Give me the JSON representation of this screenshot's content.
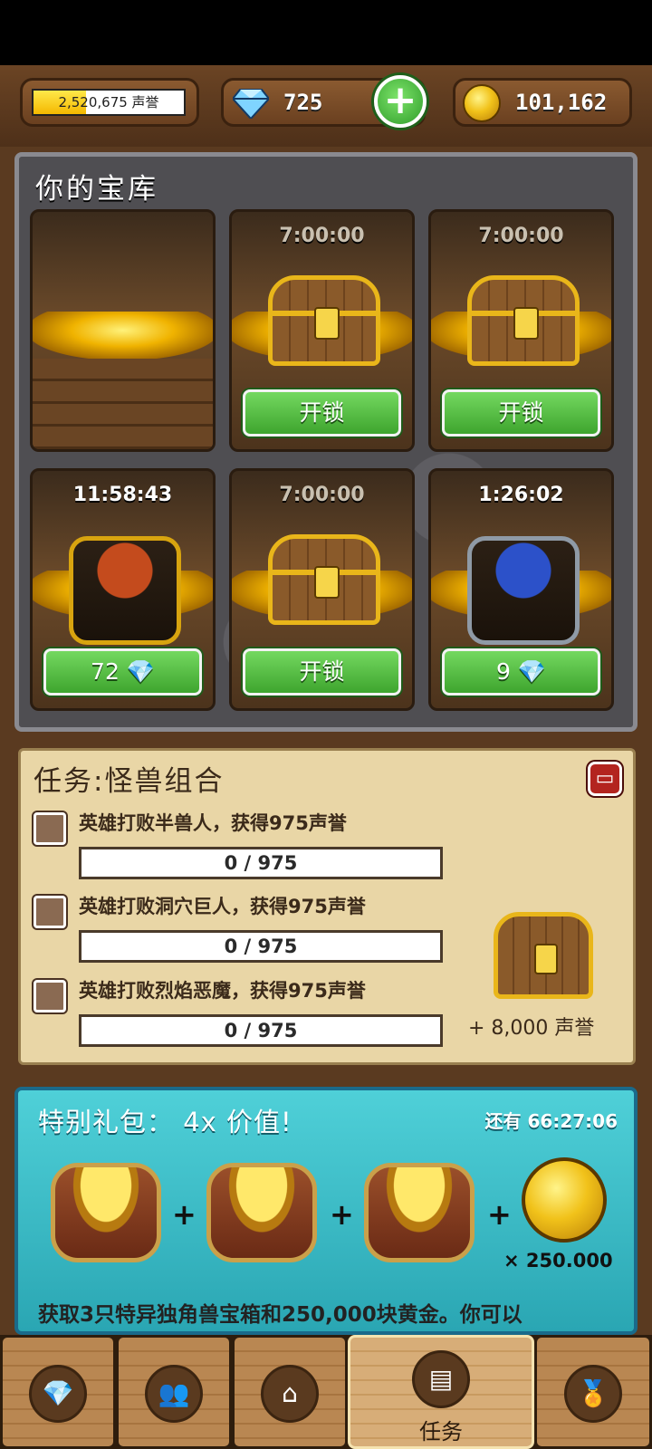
{
  "header": {
    "fame_value": "2,520,675 声誉",
    "fame_progress": 0.35,
    "gems": "725",
    "gold": "101,162",
    "add_gems_label": "+"
  },
  "vault": {
    "title": "你的宝库",
    "slots": [
      {
        "timer": "",
        "state": "empty",
        "button": ""
      },
      {
        "timer": "7:00:00",
        "state": "chest",
        "button": "开锁"
      },
      {
        "timer": "7:00:00",
        "state": "chest",
        "button": "开锁"
      },
      {
        "timer": "11:58:43",
        "state": "monster-red",
        "button": "72 💎"
      },
      {
        "timer": "7:00:00",
        "state": "chest",
        "button": "开锁"
      },
      {
        "timer": "1:26:02",
        "state": "monster-blue",
        "button": "9 💎"
      }
    ]
  },
  "quest": {
    "title": "任务:怪兽组合",
    "items": [
      {
        "text": "英雄打败半兽人，获得975声誉",
        "progress": "0 / 975"
      },
      {
        "text": "英雄打败洞穴巨人，获得975声誉",
        "progress": "0 / 975"
      },
      {
        "text": "英雄打败烈焰恶魔，获得975声誉",
        "progress": "0 / 975"
      }
    ],
    "reward": "+ 8,000 声誉",
    "close_icon": "collapse-icon"
  },
  "offer": {
    "title": "特别礼包：  4x 价值!",
    "timer": "还有 66:27:06",
    "coin_count": "× 250.000",
    "description": "获取3只特异独角兽宝箱和250,000块黄金。你可以"
  },
  "nav": {
    "items": [
      {
        "icon": "gem-icon",
        "label": ""
      },
      {
        "icon": "heroes-icon",
        "label": ""
      },
      {
        "icon": "village-icon",
        "label": ""
      },
      {
        "icon": "chest-icon",
        "label": "任务"
      },
      {
        "icon": "medal-icon",
        "label": ""
      }
    ]
  }
}
